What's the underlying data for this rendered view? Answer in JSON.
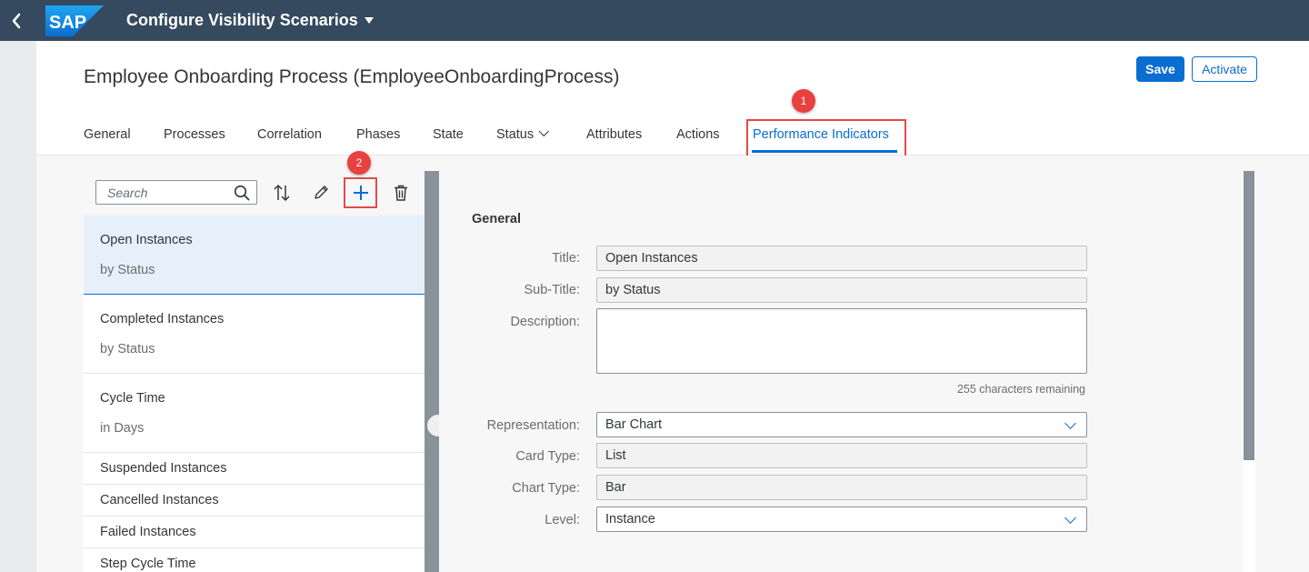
{
  "shell": {
    "logo": "SAP",
    "app_title": "Configure Visibility Scenarios"
  },
  "header": {
    "title": "Employee Onboarding Process (EmployeeOnboardingProcess)",
    "save_label": "Save",
    "activate_label": "Activate"
  },
  "tabs": [
    {
      "label": "General"
    },
    {
      "label": "Processes"
    },
    {
      "label": "Correlation"
    },
    {
      "label": "Phases"
    },
    {
      "label": "State"
    },
    {
      "label": "Status"
    },
    {
      "label": "Attributes"
    },
    {
      "label": "Actions"
    },
    {
      "label": "Performance Indicators"
    }
  ],
  "markers": {
    "one": "1",
    "two": "2"
  },
  "search": {
    "placeholder": "Search"
  },
  "list": [
    {
      "title": "Open Instances",
      "subtitle": "by Status"
    },
    {
      "title": "Completed Instances",
      "subtitle": "by Status"
    },
    {
      "title": "Cycle Time",
      "subtitle": "in Days"
    },
    {
      "title": "Suspended Instances"
    },
    {
      "title": "Cancelled Instances"
    },
    {
      "title": "Failed Instances"
    },
    {
      "title": "Step Cycle Time"
    }
  ],
  "detail": {
    "section_title": "General",
    "title_label": "Title:",
    "title_value": "Open Instances",
    "subtitle_label": "Sub-Title:",
    "subtitle_value": "by Status",
    "description_label": "Description:",
    "description_value": "",
    "counter": "255 characters remaining",
    "representation_label": "Representation:",
    "representation_value": "Bar Chart",
    "card_type_label": "Card Type:",
    "card_type_value": "List",
    "chart_type_label": "Chart Type:",
    "chart_type_value": "Bar",
    "level_label": "Level:",
    "level_value": "Instance"
  },
  "colors": {
    "shell": "#354a5f",
    "accent": "#0a6ed1",
    "highlight": "#e34a4a"
  }
}
